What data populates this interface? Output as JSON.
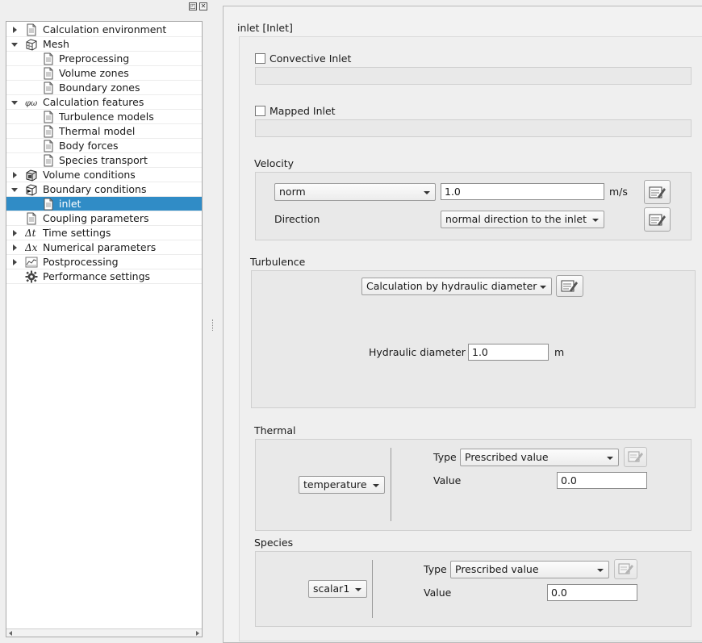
{
  "window": {
    "float_glyph": "◰",
    "close_glyph": "✕"
  },
  "tree": {
    "items": [
      {
        "label": "Calculation environment",
        "arrow": "right",
        "icon": "document-icon",
        "indent": 0
      },
      {
        "label": "Mesh",
        "arrow": "down",
        "icon": "mesh-cube-icon",
        "indent": 0
      },
      {
        "label": "Preprocessing",
        "arrow": "",
        "icon": "document-icon",
        "indent": 1
      },
      {
        "label": "Volume zones",
        "arrow": "",
        "icon": "document-icon",
        "indent": 1
      },
      {
        "label": "Boundary zones",
        "arrow": "",
        "icon": "document-icon",
        "indent": 1
      },
      {
        "label": "Calculation features",
        "arrow": "down",
        "icon": "phi-icon",
        "indent": 0
      },
      {
        "label": "Turbulence models",
        "arrow": "",
        "icon": "document-icon",
        "indent": 1
      },
      {
        "label": "Thermal model",
        "arrow": "",
        "icon": "document-icon",
        "indent": 1
      },
      {
        "label": "Body forces",
        "arrow": "",
        "icon": "document-icon",
        "indent": 1
      },
      {
        "label": "Species transport",
        "arrow": "",
        "icon": "document-icon",
        "indent": 1
      },
      {
        "label": "Volume conditions",
        "arrow": "right",
        "icon": "volume-cube-icon",
        "indent": 0
      },
      {
        "label": "Boundary conditions",
        "arrow": "down",
        "icon": "boundary-cube-icon",
        "indent": 0
      },
      {
        "label": "inlet",
        "arrow": "",
        "icon": "document-icon",
        "indent": 1,
        "selected": true
      },
      {
        "label": "Coupling parameters",
        "arrow": "",
        "icon": "document-icon",
        "indent": 0
      },
      {
        "label": "Time settings",
        "arrow": "right",
        "icon": "delta-t-icon",
        "indent": 0
      },
      {
        "label": "Numerical parameters",
        "arrow": "right",
        "icon": "delta-x-icon",
        "indent": 0
      },
      {
        "label": "Postprocessing",
        "arrow": "right",
        "icon": "chart-icon",
        "indent": 0
      },
      {
        "label": "Performance settings",
        "arrow": "",
        "icon": "gear-icon",
        "indent": 0
      }
    ]
  },
  "panel": {
    "title": "inlet [Inlet]",
    "convective_inlet": {
      "label": "Convective Inlet",
      "checked": false
    },
    "mapped_inlet": {
      "label": "Mapped Inlet",
      "checked": false
    },
    "velocity": {
      "title": "Velocity",
      "choice": "norm",
      "value": "1.0",
      "unit": "m/s",
      "direction_label": "Direction",
      "direction_choice": "normal direction to the inlet"
    },
    "turbulence": {
      "title": "Turbulence",
      "choice": "Calculation by hydraulic diameter",
      "hd_label": "Hydraulic diameter",
      "hd_value": "1.0",
      "hd_unit": "m"
    },
    "thermal": {
      "title": "Thermal",
      "variable": "temperature",
      "type_label": "Type",
      "type_choice": "Prescribed value",
      "value_label": "Value",
      "value": "0.0"
    },
    "species": {
      "title": "Species",
      "variable": "scalar1",
      "type_label": "Type",
      "type_choice": "Prescribed value",
      "value_label": "Value",
      "value": "0.0"
    }
  },
  "colors": {
    "selection": "#308cc6",
    "group_bg": "#e9e9e9"
  }
}
